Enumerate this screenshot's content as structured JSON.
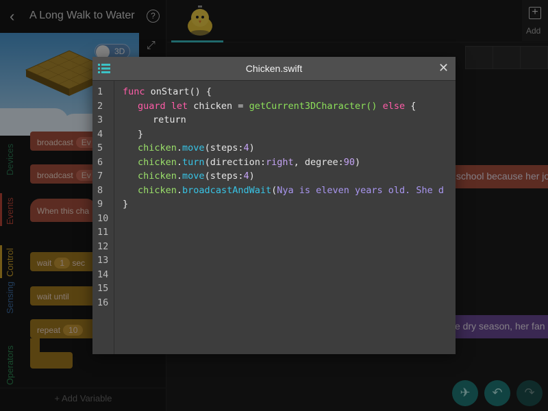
{
  "app": {
    "title": "A Long Walk to Water",
    "help_label": "?",
    "add_label": "Add",
    "toggle_3d_label": "3D",
    "add_variable_label": "+ Add Variable"
  },
  "categories": [
    {
      "label": "Devices",
      "color": "#2d7a55"
    },
    {
      "label": "Events",
      "color": "#c0473a"
    },
    {
      "label": "Control",
      "color": "#d4a72c"
    },
    {
      "label": "Sensing",
      "color": "#3f6fa6"
    },
    {
      "label": "Operators",
      "color": "#2f8a54"
    }
  ],
  "palette_blocks": {
    "broadcast1": "broadcast",
    "broadcast1_val": "Ev",
    "broadcast2": "broadcast",
    "broadcast2_val": "Ev",
    "when_this": "When this cha",
    "wait": "wait",
    "wait_val": "1",
    "wait_unit": "sec",
    "wait_until": "wait until",
    "repeat": "repeat",
    "repeat_val": "10"
  },
  "background_blocks": {
    "school": "school because her jo",
    "dry_season": "e dry season, her fan"
  },
  "editor": {
    "filename": "Chicken.swift",
    "lines": [
      "1",
      "2",
      "3",
      "4",
      "5",
      "6",
      "7",
      "8",
      "9",
      "10",
      "11",
      "12",
      "13",
      "14",
      "15",
      "16"
    ],
    "code": {
      "l1_kw": "func",
      "l1_rest": " onStart() {",
      "l2_kw": "guard let",
      "l2_var": " chicken = ",
      "l2_fn": "getCurrent3DCharacter()",
      "l2_else": " else",
      "l2_brace": " {",
      "l3": "return",
      "l4": "}",
      "l5_obj": "chicken",
      "l5_method": "move",
      "l5_args_a": "(steps:",
      "l5_num": "4",
      "l5_args_b": ")",
      "l6_obj": "chicken",
      "l6_method": "turn",
      "l6_args_a": "(direction:",
      "l6_dir": "right",
      "l6_args_b": ", degree:",
      "l6_num": "90",
      "l6_args_c": ")",
      "l7_obj": "chicken",
      "l7_method": "move",
      "l7_args_a": "(steps:",
      "l7_num": "4",
      "l7_args_b": ")",
      "l8_obj": "chicken",
      "l8_method": "broadcastAndWait",
      "l8_paren": "(",
      "l8_str": "Nya is eleven years old. She d",
      "l9": "}"
    }
  },
  "colors": {
    "accent_teal": "#3cc2c6",
    "events_block": "#a8503e",
    "control_block": "#a37a1f",
    "looks_block": "#6a4a96"
  }
}
